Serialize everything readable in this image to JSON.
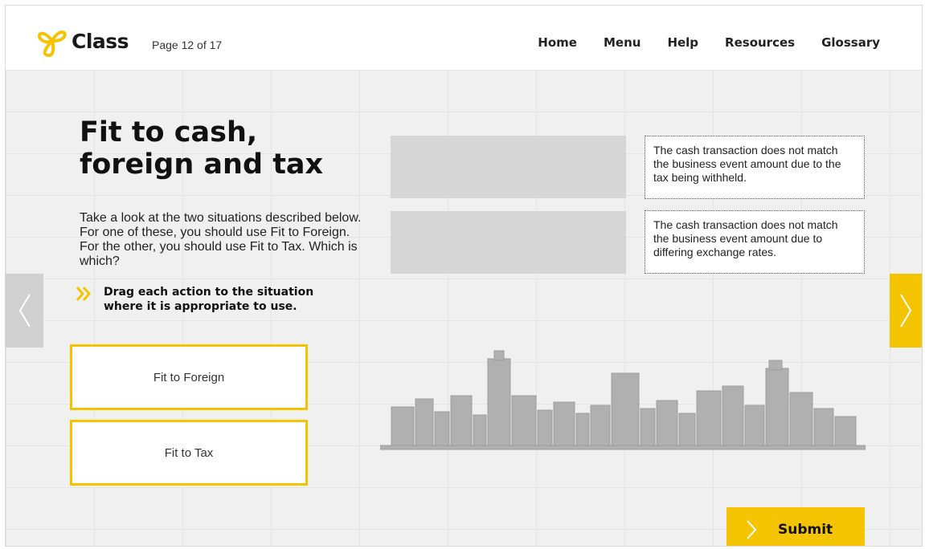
{
  "header": {
    "logo_text": "Class",
    "page_indicator": "Page 12 of 17",
    "nav": [
      "Home",
      "Menu",
      "Help",
      "Resources",
      "Glossary"
    ]
  },
  "main": {
    "title_line1": "Fit to cash,",
    "title_line2": "foreign and tax",
    "intro": "Take a look at the two situations described below. For one of these, you should use Fit to Foreign. For the other, you should use Fit to Tax. Which is which?",
    "instruction": "Drag each action to the situation where it is appropriate to use.",
    "drag_items": [
      "Fit to Foreign",
      "Fit to Tax"
    ],
    "situations": [
      "The cash transaction does not match the business event amount due to the tax being withheld.",
      "The cash transaction does not match the business event amount due to differing exchange rates."
    ],
    "submit_label": "Submit"
  },
  "icons": {
    "prev": "chevron-left-icon",
    "next": "chevron-right-icon",
    "instruction": "double-chevron-icon",
    "submit": "chevron-right-icon",
    "logo": "knot-logo-icon",
    "illustration": "city-skyline-illustration"
  },
  "colors": {
    "accent": "#f5c400",
    "drop_zone": "#d6d6d6",
    "prev_arrow_bg": "#d0d0d0",
    "background": "#f0f0f0"
  }
}
